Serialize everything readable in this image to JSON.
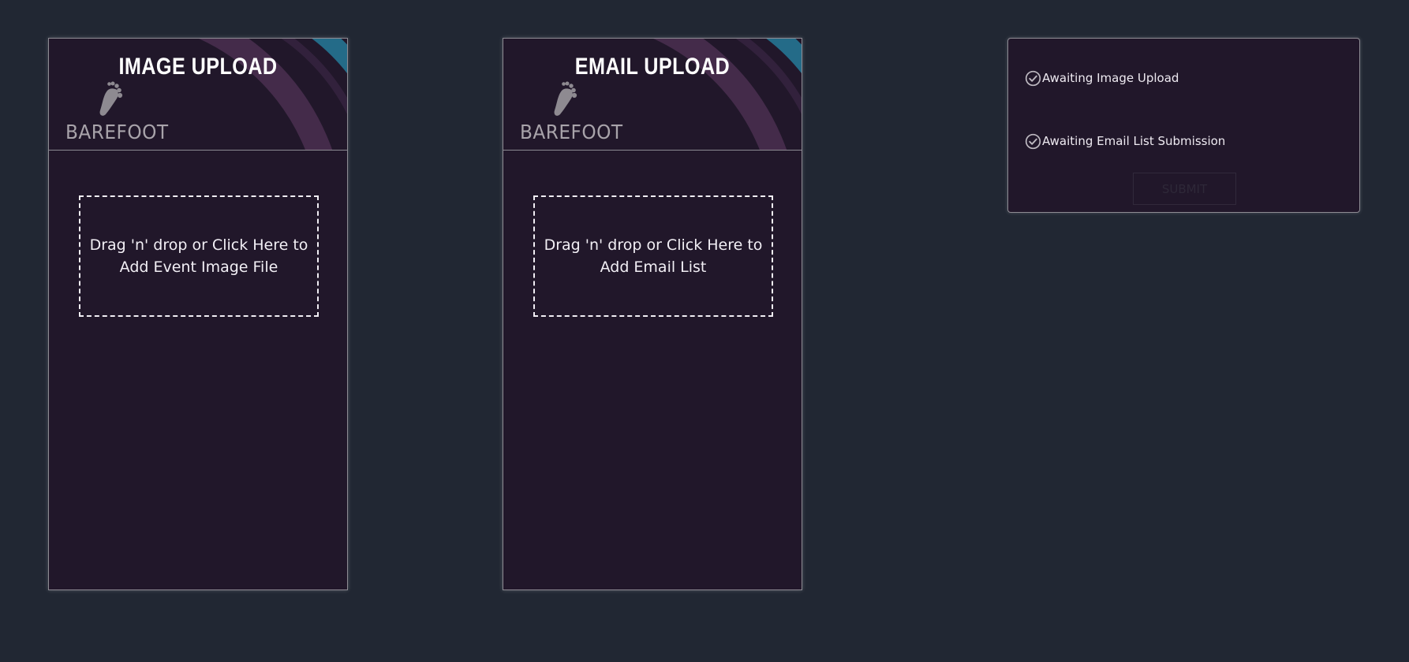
{
  "image_upload": {
    "title": "IMAGE UPLOAD",
    "brand": "BAREFOOT",
    "dropzone_text": "Drag 'n' drop or Click Here to Add Event Image File"
  },
  "email_upload": {
    "title": "EMAIL UPLOAD",
    "brand": "BAREFOOT",
    "dropzone_text": "Drag 'n' drop or Click Here to Add Email List"
  },
  "status": {
    "items": [
      {
        "icon": "check-circle-icon",
        "label": "Awaiting Image Upload"
      },
      {
        "icon": "check-circle-icon",
        "label": "Awaiting Email List Submission"
      }
    ],
    "submit_label": "SUBMIT"
  },
  "colors": {
    "page_background": "#212733",
    "panel_background": "#21172a",
    "arc_purple": "#4a2f50",
    "arc_blue": "#246b88",
    "arc_green": "#3d7032",
    "arc_gold": "#b98b30"
  }
}
